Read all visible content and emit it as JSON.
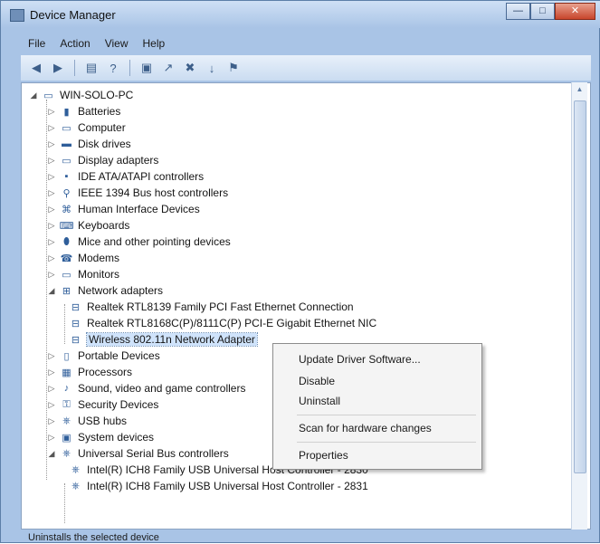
{
  "window": {
    "title": "Device Manager",
    "controls": {
      "minimize": "—",
      "maximize": "□",
      "close": "✕"
    }
  },
  "menu": [
    "File",
    "Action",
    "View",
    "Help"
  ],
  "toolbar_icons": [
    "back-arrow-icon",
    "forward-arrow-icon",
    "properties-icon",
    "help-icon",
    "scan-hardware-icon",
    "update-driver-icon",
    "uninstall-icon",
    "disable-icon",
    "enable-icon"
  ],
  "tree": {
    "root": "WIN-SOLO-PC",
    "categories": [
      {
        "label": "Batteries",
        "icon": "battery-icon"
      },
      {
        "label": "Computer",
        "icon": "computer-icon"
      },
      {
        "label": "Disk drives",
        "icon": "disk-icon"
      },
      {
        "label": "Display adapters",
        "icon": "monitor-icon"
      },
      {
        "label": "IDE ATA/ATAPI controllers",
        "icon": "ide-controller-icon"
      },
      {
        "label": "IEEE 1394 Bus host controllers",
        "icon": "ieee1394-icon"
      },
      {
        "label": "Human Interface Devices",
        "icon": "hid-icon"
      },
      {
        "label": "Keyboards",
        "icon": "keyboard-icon"
      },
      {
        "label": "Mice and other pointing devices",
        "icon": "mouse-icon"
      },
      {
        "label": "Modems",
        "icon": "modem-icon"
      },
      {
        "label": "Monitors",
        "icon": "monitor-icon"
      },
      {
        "label": "Network adapters",
        "icon": "network-icon",
        "expanded": true,
        "children": [
          "Realtek RTL8139 Family PCI Fast Ethernet Connection",
          "Realtek RTL8168C(P)/8111C(P) PCI-E Gigabit Ethernet NIC",
          "Wireless 802.11n Network Adapter"
        ]
      },
      {
        "label": "Portable Devices",
        "icon": "portable-device-icon"
      },
      {
        "label": "Processors",
        "icon": "processor-icon"
      },
      {
        "label": "Sound, video and game controllers",
        "icon": "sound-icon"
      },
      {
        "label": "Security Devices",
        "icon": "security-icon"
      },
      {
        "label": "USB hubs",
        "icon": "usb-icon"
      },
      {
        "label": "System devices",
        "icon": "system-icon"
      },
      {
        "label": "Universal Serial Bus controllers",
        "icon": "usb-icon",
        "expanded": true,
        "children": [
          "Intel(R) ICH8 Family USB Universal Host Controller - 2830",
          "Intel(R) ICH8 Family USB Universal Host Controller - 2831"
        ]
      }
    ]
  },
  "context_menu": {
    "items": [
      "Update Driver Software...",
      "Disable",
      "Uninstall",
      "Scan for hardware changes",
      "Properties"
    ]
  },
  "status_bar": "Uninstalls the selected device"
}
